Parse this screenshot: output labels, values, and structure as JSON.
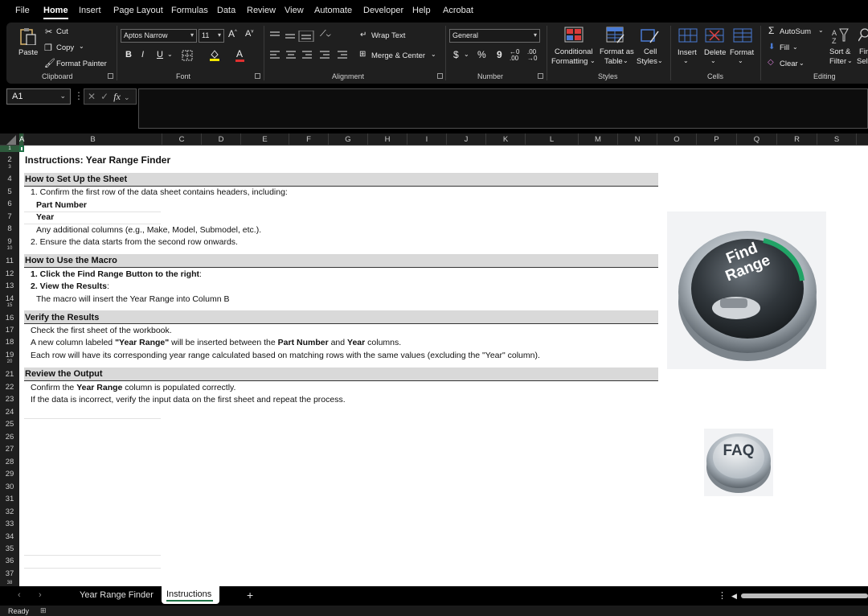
{
  "menu": [
    "File",
    "Home",
    "Insert",
    "Page Layout",
    "Formulas",
    "Data",
    "Review",
    "View",
    "Automate",
    "Developer",
    "Help",
    "Acrobat"
  ],
  "ribbon": {
    "clipboard": {
      "paste": "Paste",
      "cut": "Cut",
      "copy": "Copy",
      "format_painter": "Format Painter",
      "label": "Clipboard"
    },
    "font": {
      "name": "Aptos Narrow",
      "size": "11",
      "bold": "B",
      "italic": "I",
      "underline": "U",
      "label": "Font"
    },
    "alignment": {
      "wrap": "Wrap Text",
      "merge": "Merge & Center",
      "label": "Alignment"
    },
    "number": {
      "format": "General",
      "currency": "$",
      "percent": "%",
      "comma": "9",
      "label": "Number"
    },
    "styles": {
      "conditional": "Conditional",
      "conditional2": "Formatting",
      "format_as": "Format as",
      "format_as2": "Table",
      "cell": "Cell",
      "cell2": "Styles",
      "label": "Styles"
    },
    "cells": {
      "insert": "Insert",
      "delete": "Delete",
      "format": "Format",
      "label": "Cells"
    },
    "editing": {
      "autosum": "AutoSum",
      "fill": "Fill",
      "clear": "Clear",
      "sort": "Sort &",
      "sort2": "Filter",
      "find": "Fin",
      "find2": "Sele",
      "label": "Editing"
    }
  },
  "formula_bar": {
    "name_box": "A1",
    "fx": "fx"
  },
  "columns": [
    "A",
    "B",
    "C",
    "D",
    "E",
    "F",
    "G",
    "H",
    "I",
    "J",
    "K",
    "L",
    "M",
    "N",
    "O",
    "P",
    "Q",
    "R",
    "S"
  ],
  "rows": [
    "1",
    "2",
    "3",
    "4",
    "5",
    "6",
    "7",
    "8",
    "9",
    "10",
    "11",
    "12",
    "13",
    "14",
    "15",
    "16",
    "17",
    "18",
    "19",
    "20",
    "21",
    "22",
    "23",
    "24",
    "25",
    "26",
    "27",
    "28",
    "29",
    "30",
    "31",
    "32",
    "33",
    "34",
    "35",
    "36",
    "37",
    "38"
  ],
  "content": {
    "title": "Instructions: Year Range Finder",
    "s1_title": "How to Set Up the Sheet",
    "s1_l1": "1. Confirm the first row of the data sheet contains headers, including:",
    "s1_l2": "Part Number",
    "s1_l3": "Year",
    "s1_l4": "Any additional columns (e.g., Make, Model, Submodel, etc.).",
    "s1_l5": "2. Ensure the data starts from the second row onwards.",
    "s2_title": "How to Use the Macro",
    "s2_l1a": "1. Click the Find Range Button to the right",
    "s2_l1b": ":",
    "s2_l2a": "2. View the Results",
    "s2_l2b": ":",
    "s2_l3": "The macro will insert the Year Range into Column B",
    "s3_title": "Verify the Results",
    "s3_l1": "Check the first sheet of the workbook.",
    "s3_l2a": "A new column labeled ",
    "s3_l2b": "\"Year Range\"",
    "s3_l2c": " will be inserted between the ",
    "s3_l2d": "Part Number",
    "s3_l2e": " and ",
    "s3_l2f": "Year",
    "s3_l2g": " columns.",
    "s3_l3": "Each row will have its corresponding year range calculated based on matching rows with the same values (excluding the \"Year\" column).",
    "s4_title": "Review the Output",
    "s4_l1a": "Confirm the ",
    "s4_l1b": "Year Range",
    "s4_l1c": " column is populated correctly.",
    "s4_l2": "If the data is incorrect, verify the input data on the first sheet and repeat the process."
  },
  "buttons": {
    "find_range_line1": "Find",
    "find_range_line2": "Range",
    "faq": "FAQ"
  },
  "tabs": {
    "sheet1": "Year Range Finder",
    "sheet2": "Instructions",
    "add": "+"
  },
  "status": {
    "ready": "Ready"
  },
  "colors": {
    "accent_green": "#21a366",
    "section_band": "#d9d9d9"
  }
}
